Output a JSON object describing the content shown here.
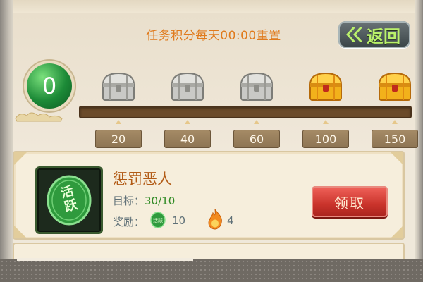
{
  "header": {
    "reset_notice": "任务积分每天00:00重置",
    "back_label": "返回"
  },
  "progress": {
    "current_points": "0",
    "milestones": [
      {
        "threshold": "20",
        "chest": "silver-chest-icon"
      },
      {
        "threshold": "40",
        "chest": "silver-chest-icon"
      },
      {
        "threshold": "60",
        "chest": "silver-chest-icon"
      },
      {
        "threshold": "100",
        "chest": "gold-chest-icon"
      },
      {
        "threshold": "150",
        "chest": "gold-chest-icon"
      }
    ]
  },
  "task": {
    "icon_text": "活跃",
    "title": "惩罚恶人",
    "target_label": "目标：",
    "target_value": "30/10",
    "reward_label": "奖励：",
    "reward_active_icon_text": "活跃",
    "reward_active_amount": "10",
    "reward_fire_amount": "4",
    "claim_label": "领取"
  },
  "colors": {
    "accent_orange": "#e07a1c",
    "title_brown": "#b25b16",
    "progress_green": "#2f8a23",
    "claim_red": "#c9332b",
    "back_text_green": "#b9f06b"
  }
}
